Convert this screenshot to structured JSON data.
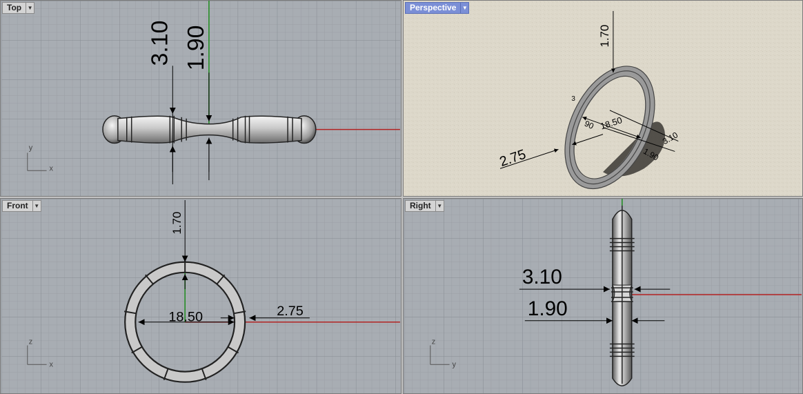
{
  "viewports": {
    "top": {
      "label": "Top",
      "axis_a": "y",
      "axis_b": "x",
      "dim_a": "3.10",
      "dim_b": "1.90"
    },
    "perspective": {
      "label": "Perspective",
      "dim_top": "1.70",
      "dim_side": "2.75",
      "dim_diam": "18.50",
      "dim_c": "3.10",
      "dim_d": "1.90",
      "dim_e": "90",
      "dim_f": "3"
    },
    "front": {
      "label": "Front",
      "axis_a": "z",
      "axis_b": "x",
      "dim_top": "1.70",
      "dim_diam": "18.50",
      "dim_side": "2.75"
    },
    "right": {
      "label": "Right",
      "axis_a": "z",
      "axis_b": "y",
      "dim_a": "3.10",
      "dim_b": "1.90"
    }
  },
  "colors": {
    "grid_bg": "#a8adb3",
    "grid_minor": "#9aa0a6",
    "grid_major": "#8a9097",
    "x_axis": "#b22222",
    "y_axis": "#1a8a1a",
    "paper": "#ddd8ca"
  }
}
